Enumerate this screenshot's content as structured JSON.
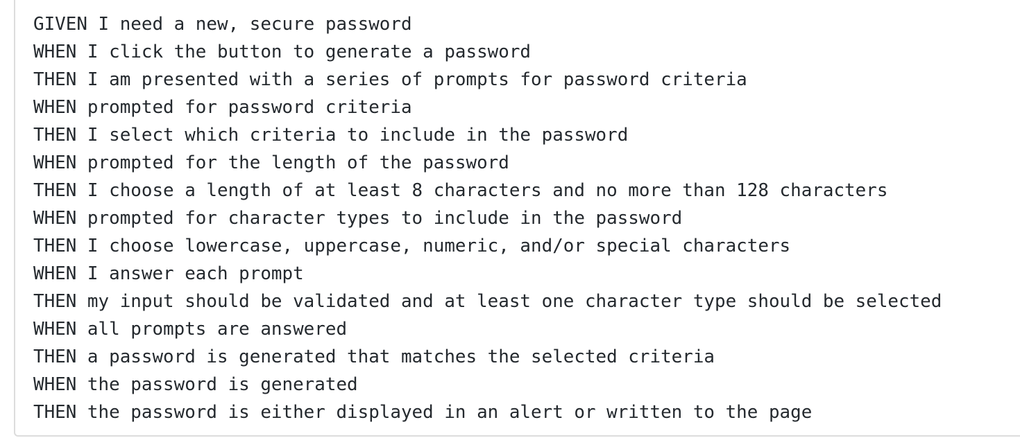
{
  "code_block": {
    "lines": [
      "GIVEN I need a new, secure password",
      "WHEN I click the button to generate a password",
      "THEN I am presented with a series of prompts for password criteria",
      "WHEN prompted for password criteria",
      "THEN I select which criteria to include in the password",
      "WHEN prompted for the length of the password",
      "THEN I choose a length of at least 8 characters and no more than 128 characters",
      "WHEN prompted for character types to include in the password",
      "THEN I choose lowercase, uppercase, numeric, and/or special characters",
      "WHEN I answer each prompt",
      "THEN my input should be validated and at least one character type should be selected",
      "WHEN all prompts are answered",
      "THEN a password is generated that matches the selected criteria",
      "WHEN the password is generated",
      "THEN the password is either displayed in an alert or written to the page"
    ]
  }
}
